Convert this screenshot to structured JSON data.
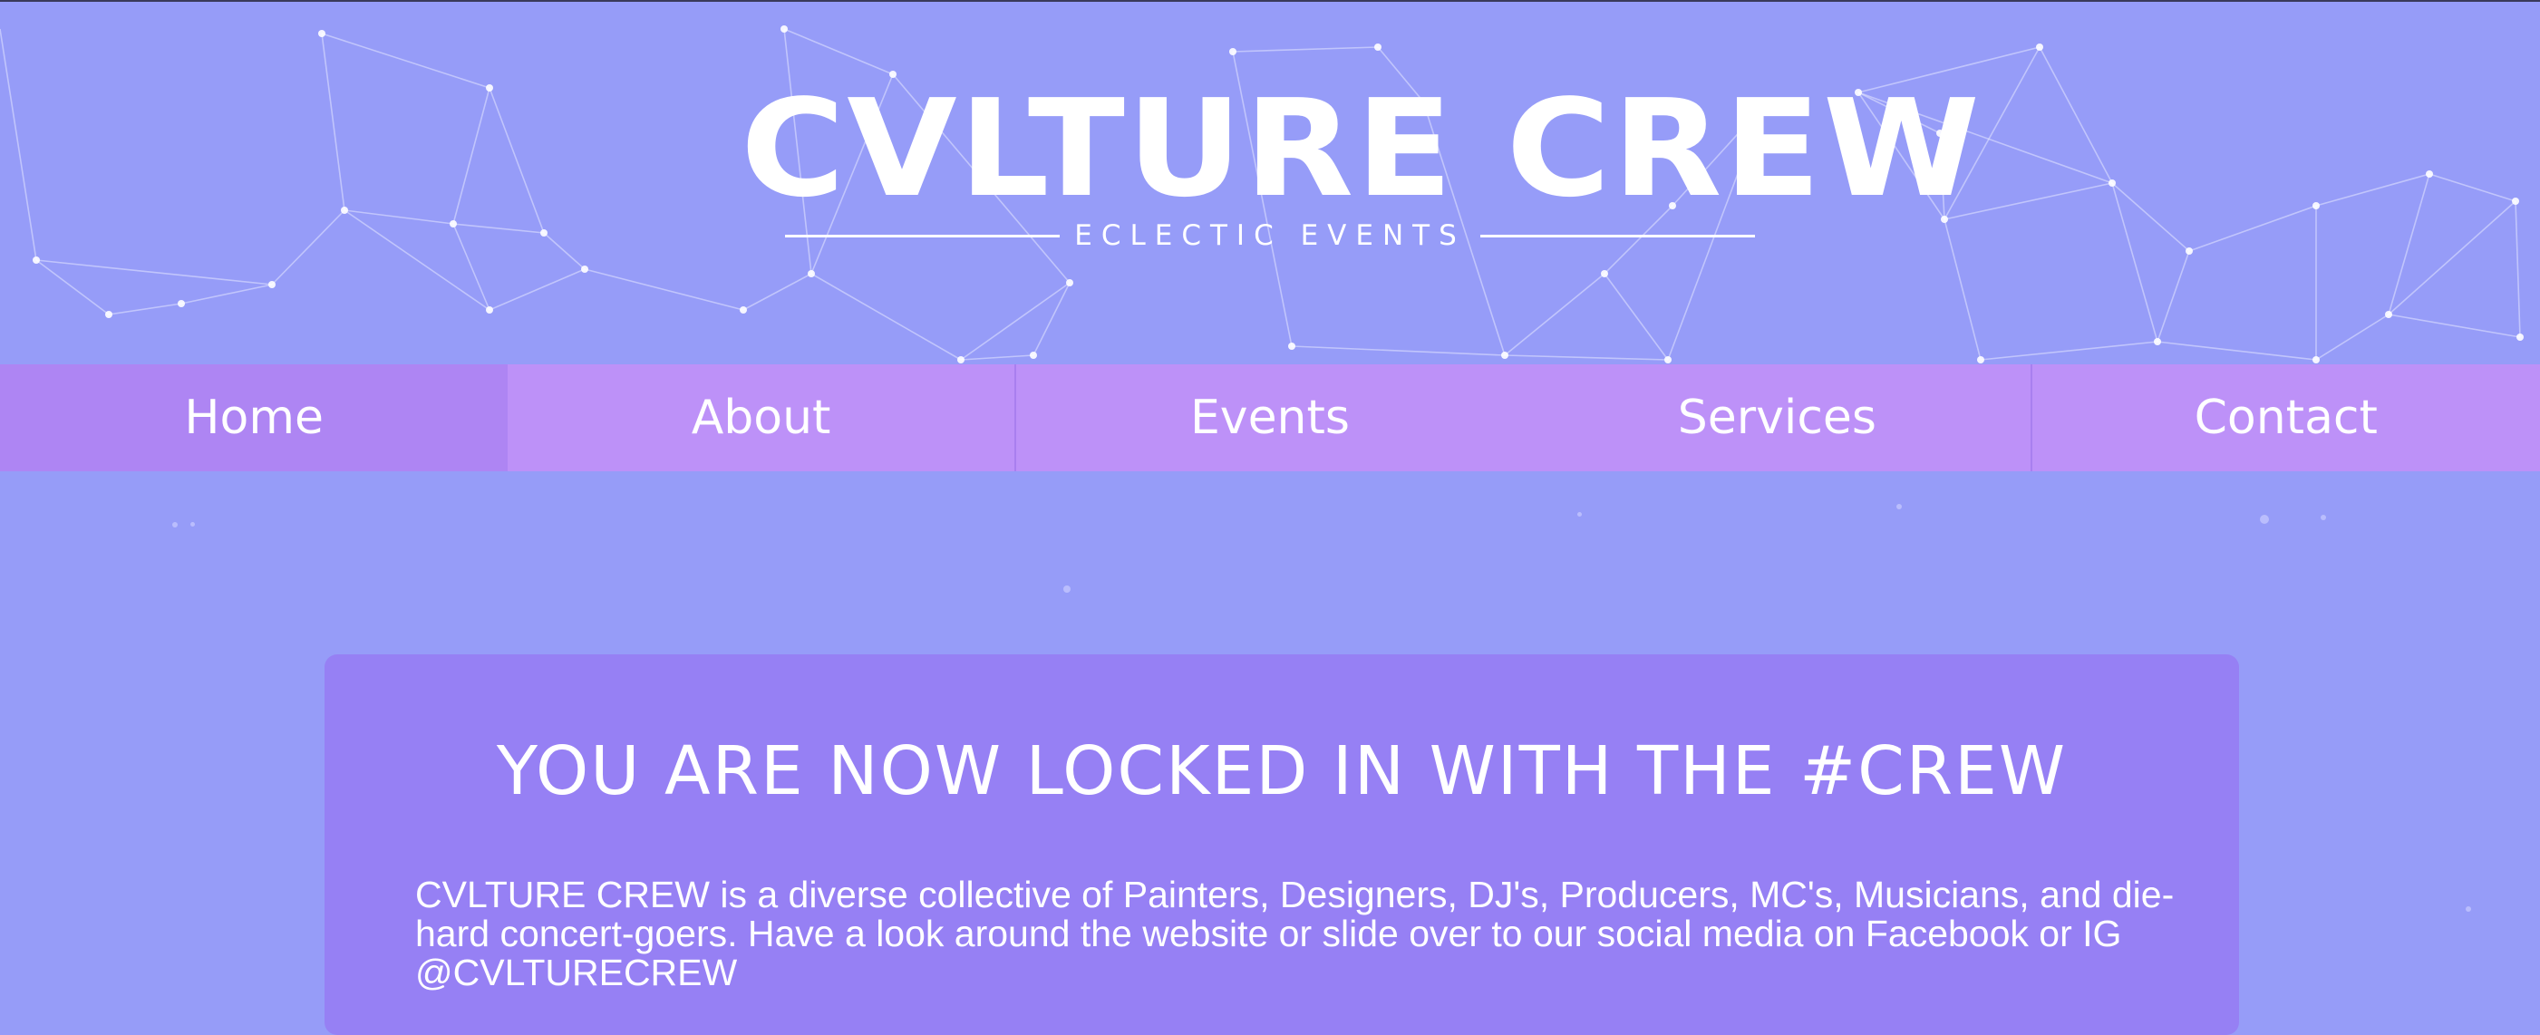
{
  "logo": {
    "title": "CVLTURE CREW",
    "subtitle": "ECLECTIC EVENTS"
  },
  "nav": {
    "items": [
      {
        "label": "Home"
      },
      {
        "label": "About"
      },
      {
        "label": "Events"
      },
      {
        "label": "Services"
      },
      {
        "label": "Contact"
      }
    ]
  },
  "hero": {
    "title": "YOU ARE NOW LOCKED IN WITH THE #CREW",
    "body": "CVLTURE CREW is a diverse collective of Painters, Designers, DJ's, Producers, MC's, Musicians, and die-hard concert-goers. Have a look around the website or slide over to our social media on Facebook or IG @CVLTURECREW"
  },
  "colors": {
    "background": "#969cf8",
    "nav": "#bd91f8",
    "nav_active": "#ae85f3",
    "panel": "#9680f4",
    "text": "#ffffff"
  }
}
